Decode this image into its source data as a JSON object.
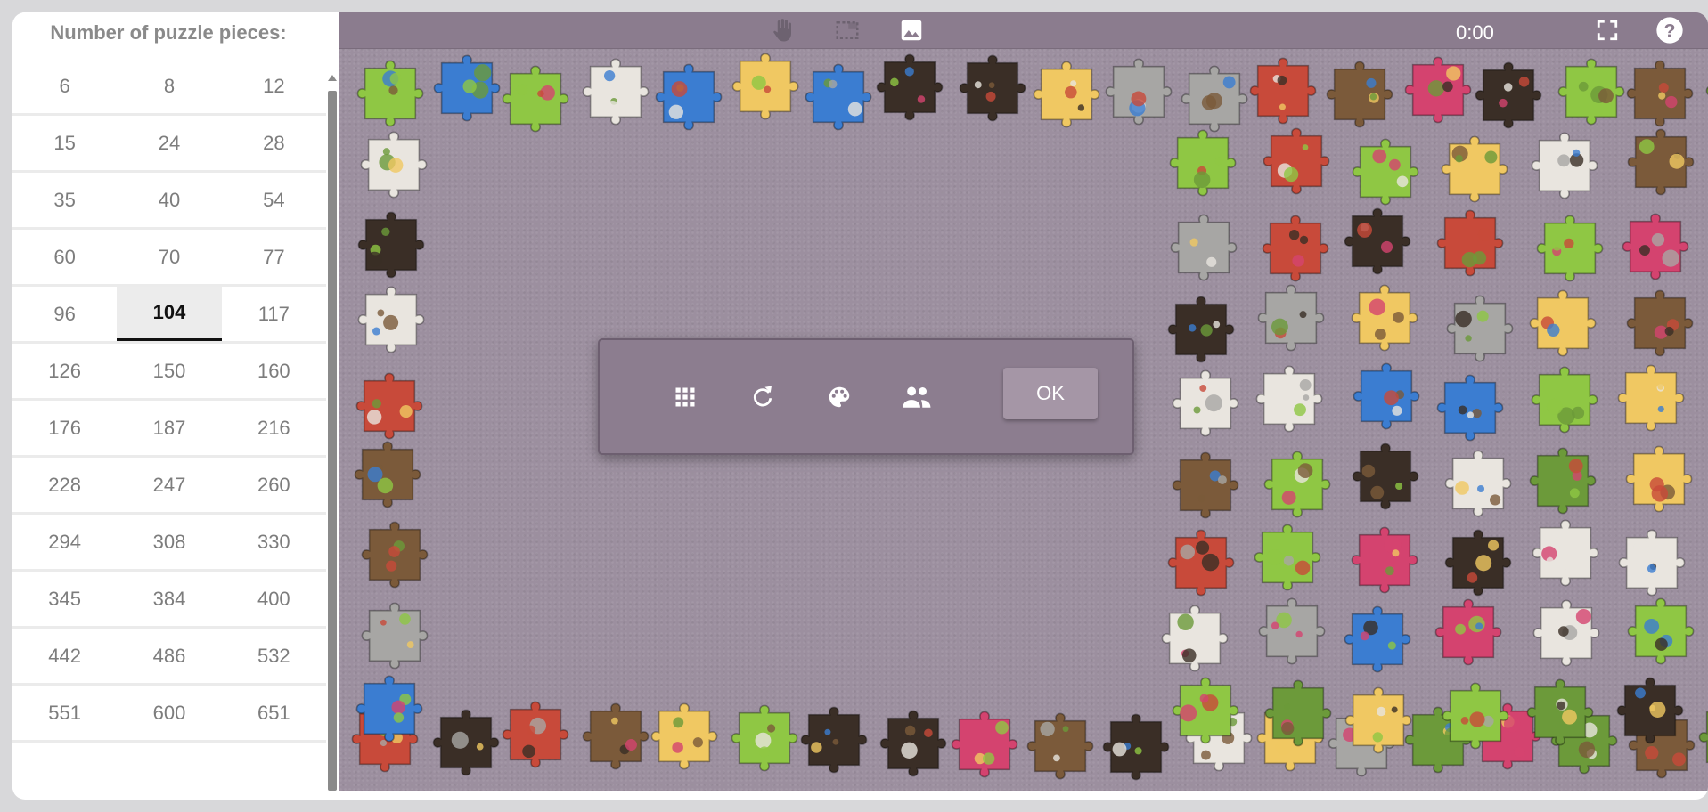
{
  "toolbar": {
    "icons": [
      "hand-icon",
      "selection-box-icon",
      "image-icon",
      "fullscreen-icon",
      "help-icon"
    ],
    "timer": "0:00"
  },
  "dialog": {
    "icons": [
      "grid-icon",
      "rotate-icon",
      "palette-icon",
      "people-icon"
    ],
    "ok_label": "OK"
  },
  "panel": {
    "title": "Number of puzzle pieces:",
    "selected": "104",
    "rows": [
      [
        "6",
        "8",
        "12"
      ],
      [
        "15",
        "24",
        "28"
      ],
      [
        "35",
        "40",
        "54"
      ],
      [
        "60",
        "70",
        "77"
      ],
      [
        "96",
        "104",
        "117"
      ],
      [
        "126",
        "150",
        "160"
      ],
      [
        "176",
        "187",
        "216"
      ],
      [
        "228",
        "247",
        "260"
      ],
      [
        "294",
        "308",
        "330"
      ],
      [
        "345",
        "384",
        "400"
      ],
      [
        "442",
        "486",
        "532"
      ],
      [
        "551",
        "600",
        "651"
      ]
    ]
  },
  "colors": {
    "board_background": "#9c8f9f",
    "toolbar_background": "#8b7c8e",
    "dialog_background": "#8c7d8f",
    "ok_button": "#a596a6",
    "piece_palette": [
      "#3a2e26",
      "#6c9a3a",
      "#8fc744",
      "#f0c862",
      "#3b7dd1",
      "#d4436f",
      "#e9e5df",
      "#7b5a3a",
      "#a7a6a4",
      "#c84a3a"
    ]
  }
}
